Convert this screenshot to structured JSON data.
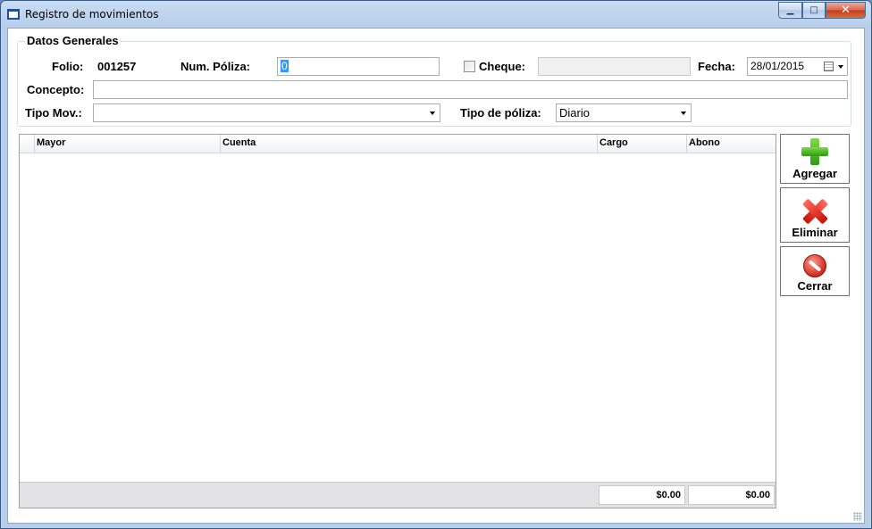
{
  "window": {
    "title": "Registro de movimientos",
    "minimize": "▁",
    "maximize": "□",
    "close": "✕"
  },
  "datos_generales": {
    "legend": "Datos Generales",
    "folio_label": "Folio:",
    "folio_value": "001257",
    "num_poliza_label": "Num. Póliza:",
    "num_poliza_value": "0",
    "cheque_label": "Cheque:",
    "cheque_checked": false,
    "cheque_value": "",
    "fecha_label": "Fecha:",
    "fecha_value": "28/01/2015",
    "concepto_label": "Concepto:",
    "concepto_value": "",
    "tipo_mov_label": "Tipo Mov.:",
    "tipo_mov_value": "",
    "tipo_poliza_label": "Tipo de póliza:",
    "tipo_poliza_value": "Diario"
  },
  "grid": {
    "columns": [
      "Mayor",
      "Cuenta",
      "Cargo",
      "Abono"
    ],
    "rows": [],
    "total_cargo": "$0.00",
    "total_abono": "$0.00"
  },
  "actions": {
    "agregar": "Agregar",
    "eliminar": "Eliminar",
    "cerrar": "Cerrar"
  },
  "icons": {
    "agregar": "plus-icon",
    "eliminar": "x-icon",
    "cerrar": "ban-icon",
    "fecha": "calendar-icon"
  },
  "colors": {
    "selection": "#3399ff",
    "plus_green": "#2f9a15",
    "delete_red": "#c8120a"
  }
}
